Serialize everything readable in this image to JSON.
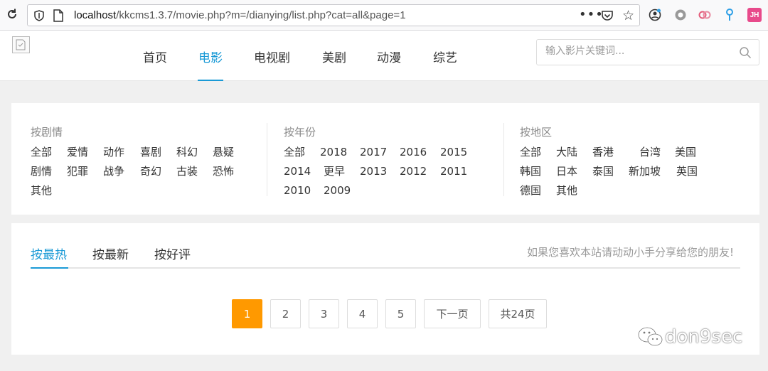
{
  "browser": {
    "url_host": "localhost",
    "url_path": "/kkcms1.3.7/movie.php?m=/dianying/list.php?cat=all&page=1",
    "more_label": "•••",
    "ext_avatar_label": "JH"
  },
  "header": {
    "nav": [
      "首页",
      "电影",
      "电视剧",
      "美剧",
      "动漫",
      "综艺"
    ],
    "active_nav": "电影",
    "search_placeholder": "输入影片关键词..."
  },
  "filters": {
    "genre": {
      "title": "按剧情",
      "rows": [
        [
          "全部",
          "爱情",
          "动作",
          "喜剧",
          "科幻",
          "悬疑"
        ],
        [
          "剧情",
          "犯罪",
          "战争",
          "奇幻",
          "古装",
          "恐怖"
        ],
        [
          "其他"
        ]
      ]
    },
    "year": {
      "title": "按年份",
      "rows": [
        [
          "全部",
          "2018",
          "2017",
          "2016",
          "2015"
        ],
        [
          "2014",
          "更早",
          "2013",
          "2012",
          "2011"
        ],
        [
          "2010",
          "2009"
        ]
      ]
    },
    "region": {
      "title": "按地区",
      "rows": [
        [
          "全部",
          "大陆",
          "香港",
          "台湾",
          "美国"
        ],
        [
          "韩国",
          "日本",
          "泰国",
          "新加坡",
          "英国"
        ],
        [
          "德国",
          "其他"
        ]
      ]
    }
  },
  "sort_tabs": [
    "按最热",
    "按最新",
    "按好评"
  ],
  "active_sort": "按最热",
  "share_text": "如果您喜欢本站请动动小手分享给您的朋友!",
  "pagination": {
    "pages": [
      "1",
      "2",
      "3",
      "4",
      "5"
    ],
    "current": "1",
    "next_label": "下一页",
    "total_label": "共24页"
  },
  "watermark": "don9sec",
  "colors": {
    "accent": "#1a9ad6",
    "pager_active": "#ff9900"
  }
}
